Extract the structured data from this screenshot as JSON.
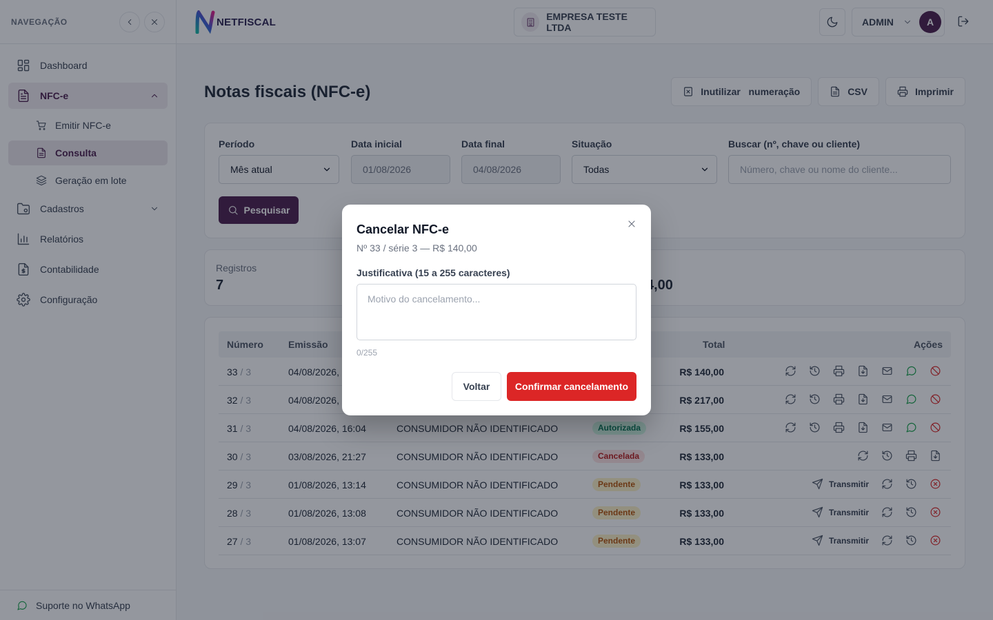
{
  "sidebar": {
    "title": "NAVEGAÇÃO",
    "items": [
      {
        "label": "Dashboard",
        "icon": "grid-icon"
      },
      {
        "label": "NFC-e",
        "icon": "document-icon"
      },
      {
        "label": "Cadastros",
        "icon": "folder-icon"
      },
      {
        "label": "Relatórios",
        "icon": "bar-chart-icon"
      },
      {
        "label": "Contabilidade",
        "icon": "file-dollar-icon"
      },
      {
        "label": "Configuração",
        "icon": "gear-icon"
      }
    ],
    "subitems": [
      {
        "label": "Emitir NFC-e",
        "icon": "cart-icon"
      },
      {
        "label": "Consulta",
        "icon": "document-icon"
      },
      {
        "label": "Geração em lote",
        "icon": "layers-icon"
      }
    ],
    "footer": "Suporte no WhatsApp"
  },
  "header": {
    "logo_net": "NET",
    "logo_fiscal": "FISCAL",
    "company": "EMPRESA TESTE LTDA",
    "user": "ADMIN",
    "avatar_initial": "A"
  },
  "page": {
    "title": "Notas fiscais (NFC-e)",
    "actions": {
      "inutilizar": "Inutilizar   numeração",
      "csv": "CSV",
      "imprimir": "Imprimir"
    }
  },
  "filters": {
    "periodo_label": "Período",
    "periodo_value": "Mês atual",
    "data_inicial_label": "Data inicial",
    "data_inicial_value": "01/08/2026",
    "data_final_label": "Data final",
    "data_final_value": "04/08/2026",
    "situacao_label": "Situação",
    "situacao_value": "Todas",
    "buscar_label": "Buscar (nº, chave ou cliente)",
    "buscar_placeholder": "Número, chave ou nome do cliente...",
    "pesquisar": "Pesquisar"
  },
  "stats": {
    "registros_label": "Registros",
    "registros_value": "7",
    "total_partial": "4,00"
  },
  "table": {
    "headers": {
      "numero": "Número",
      "emissao": "Emissão",
      "total": "Total",
      "acoes": "Ações"
    },
    "transmitir_label": "Transmitir",
    "rows": [
      {
        "num": "33",
        "serie": "/ 3",
        "emissao": "04/08/2026,",
        "cliente": "",
        "status": "",
        "total": "R$ 140,00"
      },
      {
        "num": "32",
        "serie": "/ 3",
        "emissao": "04/08/2026,",
        "cliente": "",
        "status": "",
        "total": "R$ 217,00"
      },
      {
        "num": "31",
        "serie": "/ 3",
        "emissao": "04/08/2026, 16:04",
        "cliente": "CONSUMIDOR NÃO IDENTIFICADO",
        "status": "Autorizada",
        "total": "R$ 155,00"
      },
      {
        "num": "30",
        "serie": "/ 3",
        "emissao": "03/08/2026, 21:27",
        "cliente": "CONSUMIDOR NÃO IDENTIFICADO",
        "status": "Cancelada",
        "total": "R$ 133,00"
      },
      {
        "num": "29",
        "serie": "/ 3",
        "emissao": "01/08/2026, 13:14",
        "cliente": "CONSUMIDOR NÃO IDENTIFICADO",
        "status": "Pendente",
        "total": "R$ 133,00"
      },
      {
        "num": "28",
        "serie": "/ 3",
        "emissao": "01/08/2026, 13:08",
        "cliente": "CONSUMIDOR NÃO IDENTIFICADO",
        "status": "Pendente",
        "total": "R$ 133,00"
      },
      {
        "num": "27",
        "serie": "/ 3",
        "emissao": "01/08/2026, 13:07",
        "cliente": "CONSUMIDOR NÃO IDENTIFICADO",
        "status": "Pendente",
        "total": "R$ 133,00"
      }
    ]
  },
  "modal": {
    "title": "Cancelar NFC-e",
    "subtitle": "Nº 33 / série 3 — R$ 140,00",
    "label": "Justificativa (15 a 255 caracteres)",
    "placeholder": "Motivo do cancelamento...",
    "counter": "0/255",
    "back": "Voltar",
    "confirm": "Confirmar cancelamento"
  },
  "colors": {
    "brand": "#4b1e4d",
    "danger": "#dc2626",
    "success": "#16a34a"
  }
}
